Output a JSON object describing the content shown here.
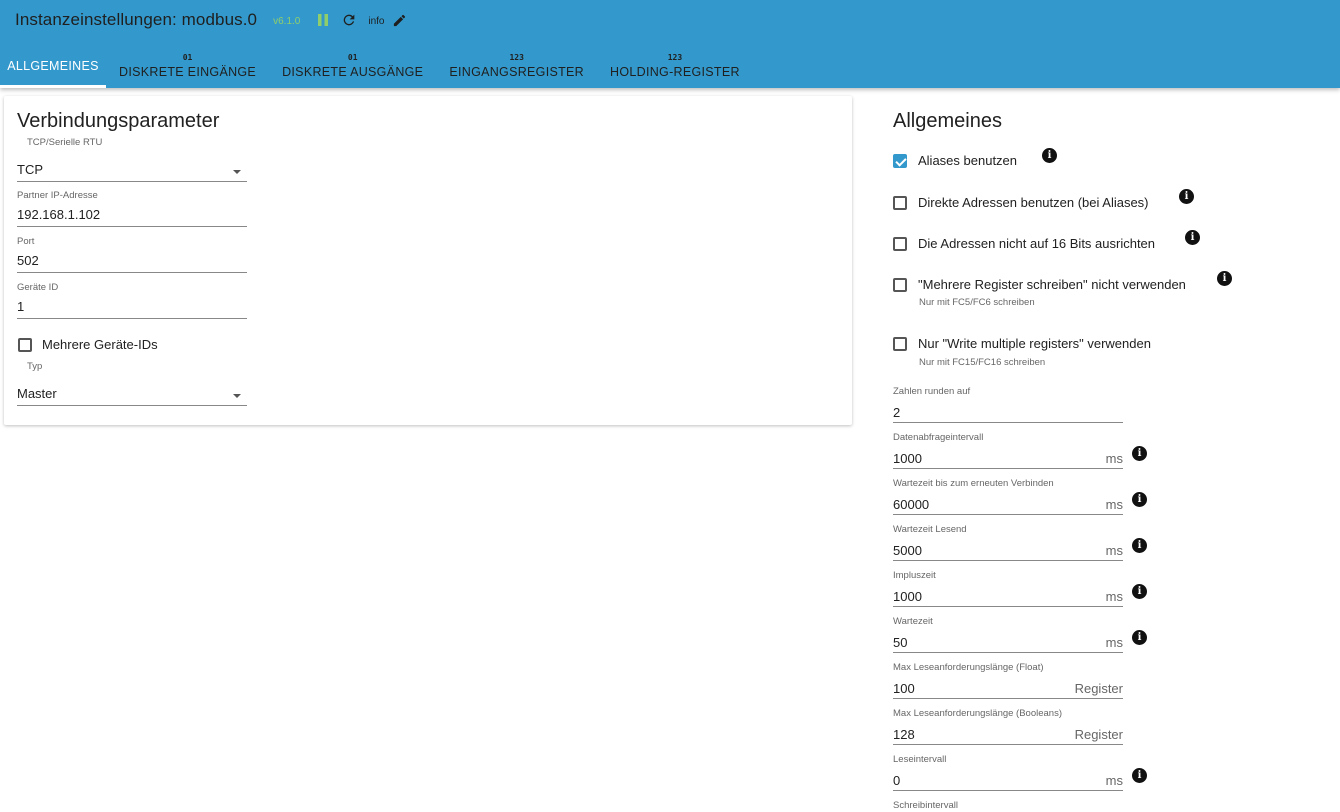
{
  "header": {
    "title": "Instanzeinstellungen: modbus.0",
    "version": "v6.1.0",
    "info_label": "info",
    "icons": [
      "pause-icon",
      "refresh-icon",
      "edit-icon"
    ],
    "colors": {
      "appbar": "#3399cc",
      "accent": "#3399cc",
      "version": "#8fce6b"
    }
  },
  "tabs": [
    {
      "icon_text": "",
      "label": "ALLGEMEINES",
      "active": true
    },
    {
      "icon_text": "01",
      "label": "DISKRETE EINGÄNGE",
      "active": false
    },
    {
      "icon_text": "01",
      "label": "DISKRETE AUSGÄNGE",
      "active": false
    },
    {
      "icon_text": "123",
      "label": "EINGANGSREGISTER",
      "active": false
    },
    {
      "icon_text": "123",
      "label": "HOLDING-REGISTER",
      "active": false
    }
  ],
  "connection": {
    "title": "Verbindungsparameter",
    "type": {
      "label": "TCP/Serielle RTU",
      "value": "TCP"
    },
    "ip": {
      "label": "Partner IP-Adresse",
      "value": "192.168.1.102"
    },
    "port": {
      "label": "Port",
      "value": "502"
    },
    "device_id": {
      "label": "Geräte ID",
      "value": "1"
    },
    "multi_ids": {
      "label": "Mehrere Geräte-IDs",
      "checked": false
    },
    "mode": {
      "label": "Typ",
      "value": "Master"
    }
  },
  "general": {
    "title": "Allgemeines",
    "checkboxes": [
      {
        "label": "Aliases benutzen",
        "checked": true,
        "help": ""
      },
      {
        "label": "Direkte Adressen benutzen (bei Aliases)",
        "checked": false,
        "help": ""
      },
      {
        "label": "Die Adressen nicht auf 16 Bits ausrichten",
        "checked": false,
        "help": ""
      },
      {
        "label": "\"Mehrere Register schreiben\" nicht verwenden",
        "checked": false,
        "help": "Nur mit FC5/FC6 schreiben"
      },
      {
        "label": "Nur \"Write multiple registers\" verwenden",
        "checked": false,
        "help": "Nur mit FC15/FC16 schreiben"
      }
    ],
    "fields": [
      {
        "label": "Zahlen runden auf",
        "value": "2",
        "unit": ""
      },
      {
        "label": "Datenabfrageintervall",
        "value": "1000",
        "unit": "ms"
      },
      {
        "label": "Wartezeit bis zum erneuten Verbinden",
        "value": "60000",
        "unit": "ms"
      },
      {
        "label": "Wartezeit Lesend",
        "value": "5000",
        "unit": "ms"
      },
      {
        "label": "Impluszeit",
        "value": "1000",
        "unit": "ms"
      },
      {
        "label": "Wartezeit",
        "value": "50",
        "unit": "ms"
      },
      {
        "label": "Max Leseanforderungslänge (Float)",
        "value": "100",
        "unit": "Register"
      },
      {
        "label": "Max Leseanforderungslänge (Booleans)",
        "value": "128",
        "unit": "Register"
      },
      {
        "label": "Leseintervall",
        "value": "0",
        "unit": "ms"
      },
      {
        "label": "Schreibintervall",
        "value": "",
        "unit": ""
      }
    ]
  }
}
